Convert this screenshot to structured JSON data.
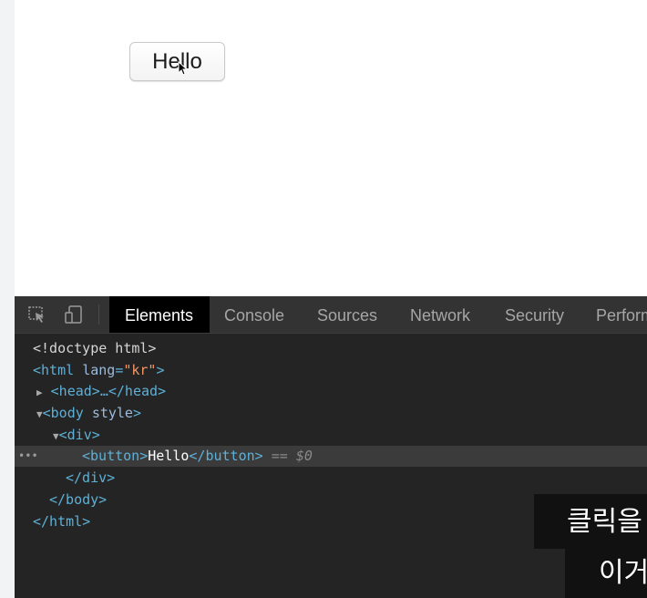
{
  "page": {
    "button_label": "Hello"
  },
  "devtools": {
    "tabs": [
      "Elements",
      "Console",
      "Sources",
      "Network",
      "Security",
      "Perform"
    ],
    "active_tab": "Elements",
    "icons": [
      "inspect-element-icon",
      "device-toolbar-icon"
    ],
    "dom": {
      "doctype": "<!doctype html>",
      "html_open_tag": "<html",
      "html_attr_name": "lang",
      "html_attr_value": "\"kr\"",
      "html_open_close": ">",
      "head_collapsed": "<head>…</head>",
      "body_open": "<body",
      "body_attr": "style",
      "body_open_close": ">",
      "div_open": "<div>",
      "button_open": "<button>",
      "button_text": "Hello",
      "button_close": "</button>",
      "selected_marker": "== ",
      "selected_var": "$0",
      "div_close": "</div>",
      "body_close": "</body>",
      "html_close": "</html>",
      "row_dots": "•••"
    }
  },
  "subtitles": {
    "line1": "클릭을",
    "line2": "이거"
  },
  "colors": {
    "tag": "#5db0d7",
    "attr_value": "#f29766",
    "devtools_bg": "#242424",
    "toolbar_bg": "#333333"
  }
}
